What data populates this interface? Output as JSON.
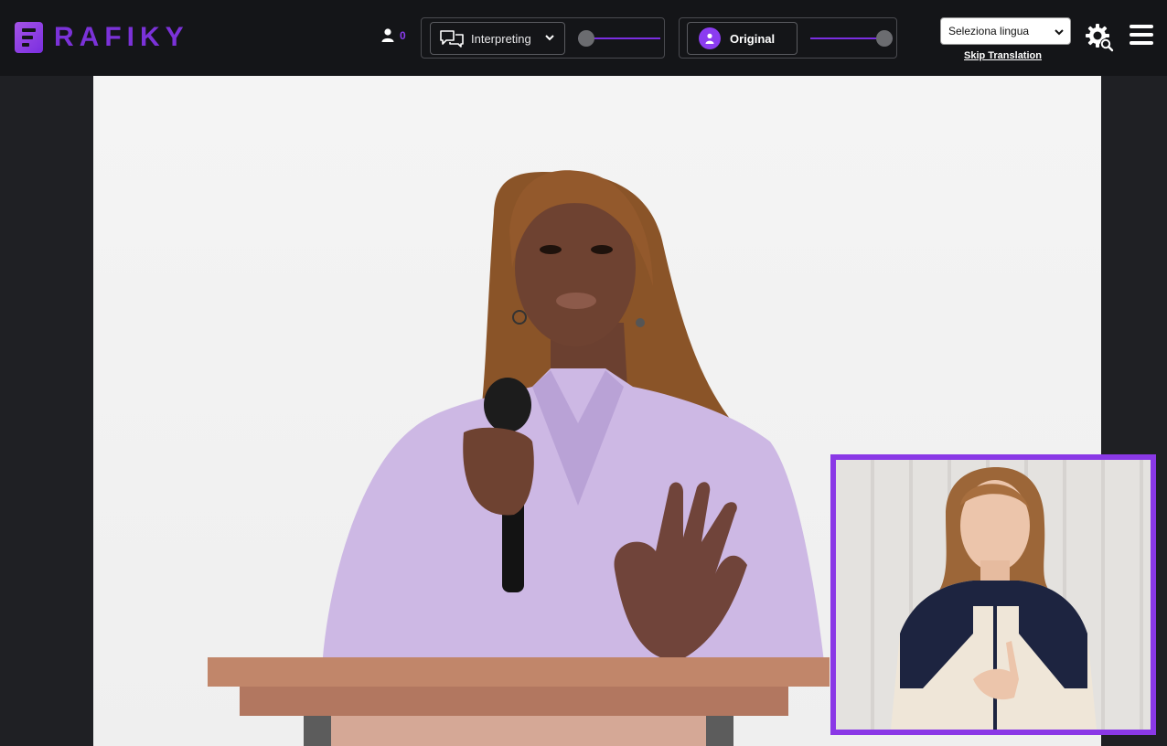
{
  "app": {
    "brand": "RAFIKY",
    "accent_color": "#8b3cf0"
  },
  "header": {
    "user_count": "0",
    "user_icon": "user-icon",
    "interpreting": {
      "icon": "chat-bubbles-icon",
      "label": "Interpreting",
      "volume_level": 0.0
    },
    "original": {
      "icon": "user-avatar-icon",
      "label": "Original",
      "volume_level": 1.0
    },
    "language_select": {
      "value": "Seleziona lingua"
    },
    "skip_translation": "Skip Translation",
    "settings_icon": "gear-icon",
    "menu_icon": "hamburger-menu-icon"
  },
  "main_video": {
    "description_icon": "video-player"
  },
  "pip_video": {
    "border_color": "#8a38e6"
  }
}
